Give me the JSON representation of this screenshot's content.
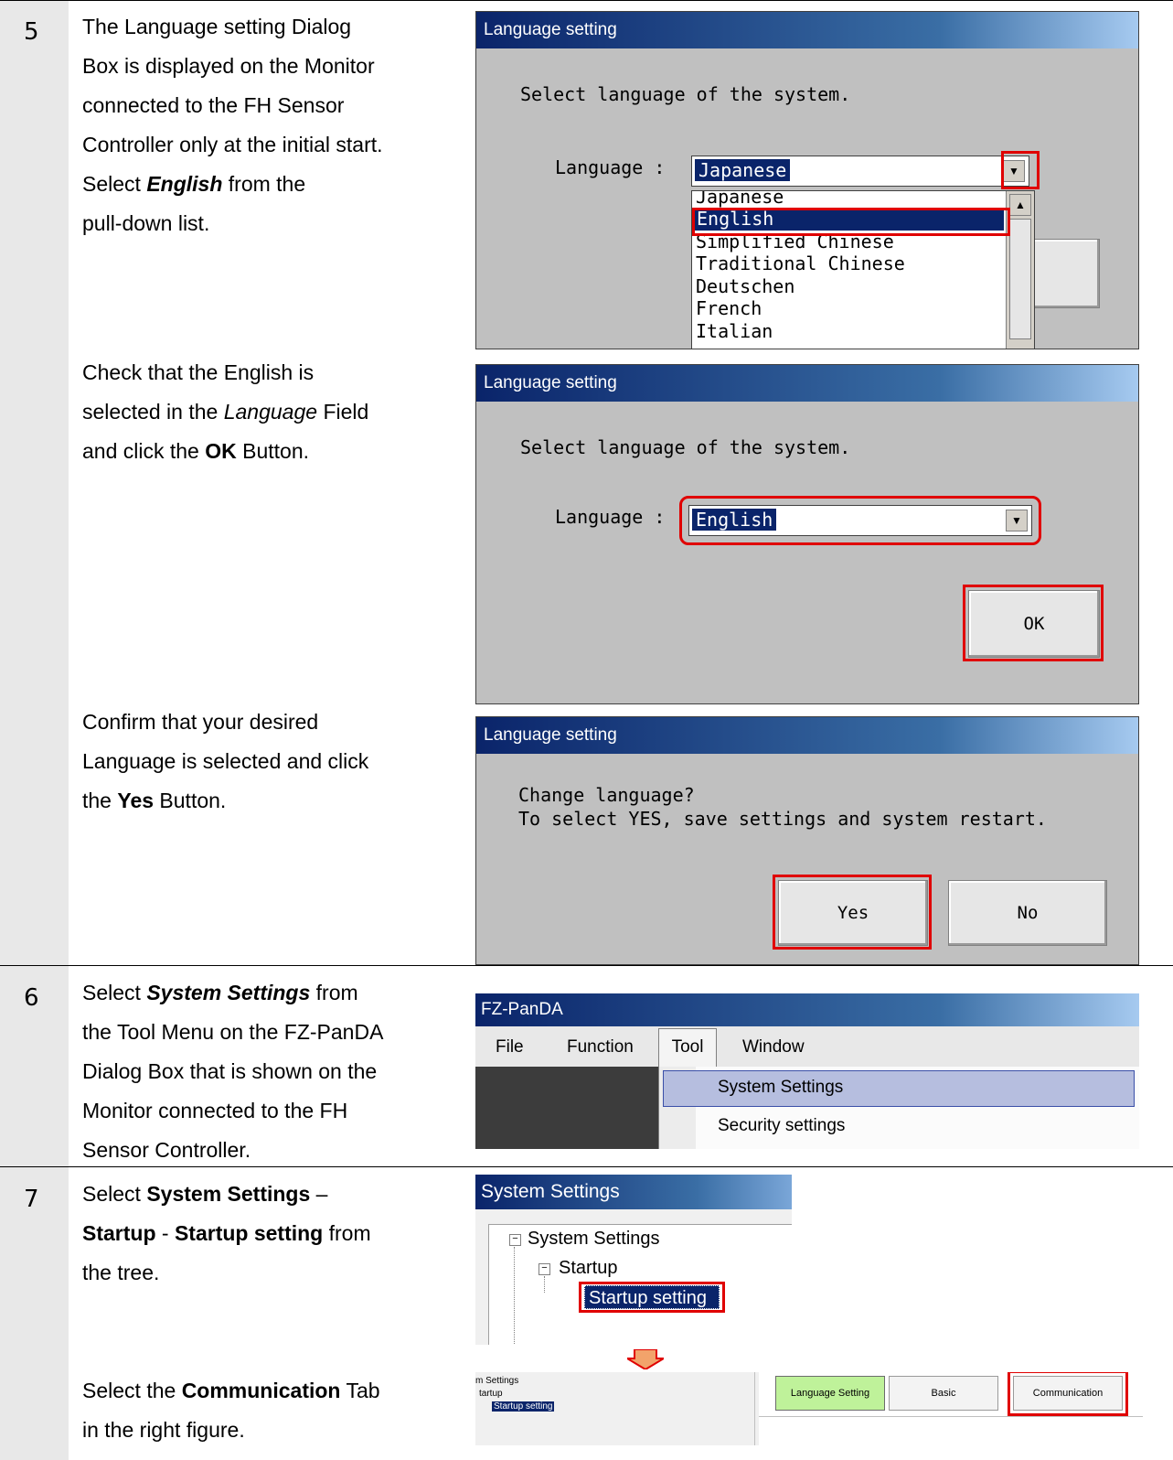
{
  "step5": {
    "num": "5",
    "desc1": [
      "The Language setting Dialog",
      "Box is displayed on the Monitor",
      "connected to the FH Sensor",
      "Controller only at the initial start."
    ],
    "desc1_select": "Select ",
    "desc1_english": "English",
    "desc1_from": " from the",
    "desc1_last": "pull-down list.",
    "desc2_line1": "Check that the English is",
    "desc2_line2_a": "selected in the ",
    "desc2_line2_lang": "Language",
    "desc2_line2_b": " Field",
    "desc2_line3_a": "and click the ",
    "desc2_line3_ok": "OK",
    "desc2_line3_b": " Button.",
    "desc3_line1": "Confirm that your desired",
    "desc3_line2": "Language is selected and click",
    "desc3_line3_a": "the ",
    "desc3_line3_yes": "Yes",
    "desc3_line3_b": " Button.",
    "dialog1": {
      "title": "Language setting",
      "prompt": "Select language of the system.",
      "label": "Language :",
      "selected": "Japanese",
      "options": [
        "Japanese",
        "English",
        "Simplified Chinese",
        "Traditional Chinese",
        "Deutschen",
        "French",
        "Italian"
      ],
      "hidden_button_fragment": "K"
    },
    "dialog2": {
      "title": "Language setting",
      "prompt": "Select language of the system.",
      "label": "Language :",
      "selected": "English",
      "ok": "OK"
    },
    "dialog3": {
      "title": "Language setting",
      "line1": "Change language?",
      "line2": "To select YES, save settings and system restart.",
      "yes": "Yes",
      "no": "No"
    }
  },
  "step6": {
    "num": "6",
    "line1_a": "Select ",
    "line1_b": "System Settings",
    "line1_c": " from",
    "lines": [
      "the Tool Menu on the FZ-PanDA",
      "Dialog Box that is shown on the",
      "Monitor connected to the FH",
      "Sensor Controller."
    ],
    "window": {
      "title": "FZ-PanDA",
      "menu": [
        "File",
        "Function",
        "Tool",
        "Window"
      ],
      "items": [
        "System Settings",
        "Security settings"
      ]
    }
  },
  "step7": {
    "num": "7",
    "line1_a": "Select ",
    "line1_b": "System Settings",
    "line1_c": " –",
    "line2_a": "Startup",
    "line2_b": " - ",
    "line2_c": "Startup setting",
    "line2_d": " from",
    "line3": "the tree.",
    "line4_a": "Select the ",
    "line4_b": "Communication",
    "line4_c": " Tab",
    "line5": "in the right figure.",
    "tree": {
      "title": "System Settings",
      "root": "System Settings",
      "child": "Startup",
      "leaf": "Startup setting"
    },
    "crop": {
      "t1": "m Settings",
      "t2": "tartup",
      "t3": "Startup setting",
      "tabs": [
        "Language Setting",
        "Basic",
        "Communication"
      ]
    }
  }
}
